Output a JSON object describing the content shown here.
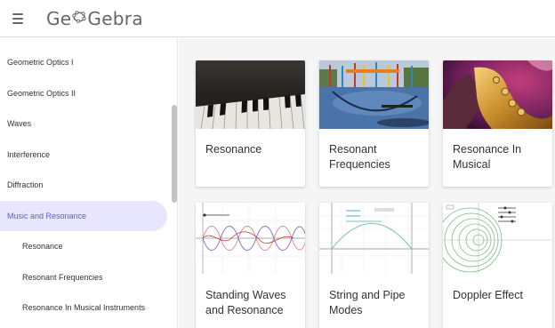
{
  "header": {
    "app_name_part1": "Ge",
    "app_name_part2": "Gebra",
    "menu_icon": "hamburger-menu-icon",
    "logo_icon": "geogebra-logo-icon"
  },
  "sidebar": {
    "items": [
      {
        "label": "Geometric Optics I"
      },
      {
        "label": "Geometric Optics II"
      },
      {
        "label": "Waves"
      },
      {
        "label": "Interference"
      },
      {
        "label": "Diffraction"
      },
      {
        "label": "Music and Resonance"
      },
      {
        "label": "Resonance"
      },
      {
        "label": "Resonant Frequencies"
      },
      {
        "label": "Resonance In Musical Instruments"
      }
    ],
    "active_color": "#6657e0",
    "active_bg": "#e8e6ff"
  },
  "cards": [
    {
      "title": "Resonance"
    },
    {
      "title": "Resonant Frequencies"
    },
    {
      "title": "Resonance In Musical"
    },
    {
      "title": "Standing Waves and Resonance"
    },
    {
      "title": "String and Pipe Modes"
    },
    {
      "title": "Doppler Effect"
    }
  ]
}
